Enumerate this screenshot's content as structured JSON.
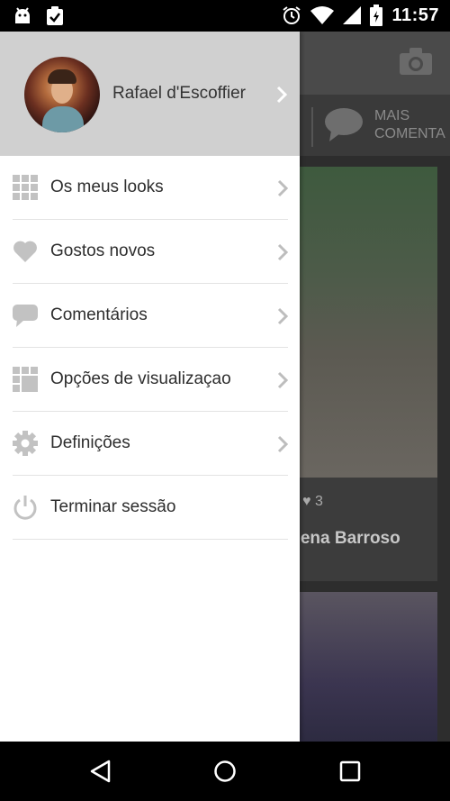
{
  "status": {
    "time": "11:57"
  },
  "background": {
    "tab_text": "MAIS\nCOMENTA",
    "likes": "3",
    "author": "elena Barroso"
  },
  "profile": {
    "name": "Rafael d'Escoffier"
  },
  "menu": [
    {
      "label": "Os meus looks",
      "icon": "grid-icon"
    },
    {
      "label": "Gostos novos",
      "icon": "heart-icon"
    },
    {
      "label": "Comentários",
      "icon": "comment-icon"
    },
    {
      "label": "Opções de visualizaçao",
      "icon": "layout-icon"
    },
    {
      "label": "Definições",
      "icon": "gear-icon"
    },
    {
      "label": "Terminar sessão",
      "icon": "power-icon"
    }
  ],
  "colors": {
    "icon": "#c2c2c2",
    "chevron": "#bdbdbd",
    "header_bg": "#d0d0d0"
  }
}
